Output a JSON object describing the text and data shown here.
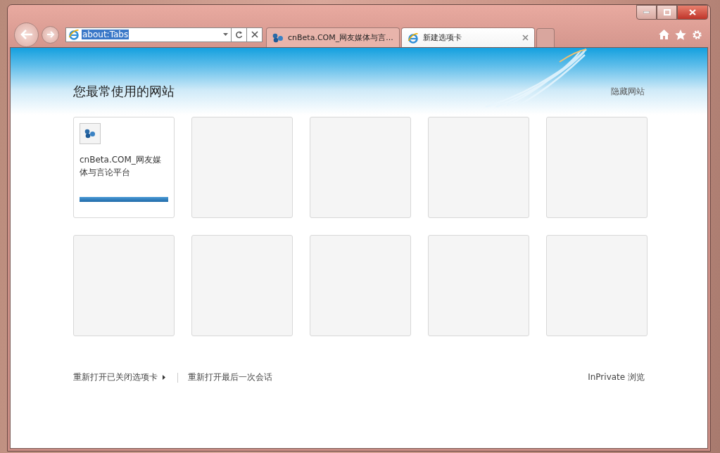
{
  "address_bar": {
    "value": "about:Tabs",
    "selected": true
  },
  "tabs": [
    {
      "kind": "site",
      "title": "cnBeta.COM_网友媒体与言...",
      "selected": false
    },
    {
      "kind": "ie",
      "title": "新建选项卡",
      "selected": true
    }
  ],
  "heading": "您最常使用的网站",
  "hide_link": "隐藏网站",
  "tiles": [
    {
      "kind": "site",
      "title": "cnBeta.COM_网友媒体与言论平台"
    },
    {
      "kind": "empty"
    },
    {
      "kind": "empty"
    },
    {
      "kind": "empty"
    },
    {
      "kind": "empty"
    },
    {
      "kind": "empty"
    },
    {
      "kind": "empty"
    },
    {
      "kind": "empty"
    },
    {
      "kind": "empty"
    },
    {
      "kind": "empty"
    }
  ],
  "footer": {
    "reopen_closed": "重新打开已关闭选项卡",
    "reopen_session": "重新打开最后一次会话",
    "inprivate": "InPrivate 浏览"
  }
}
